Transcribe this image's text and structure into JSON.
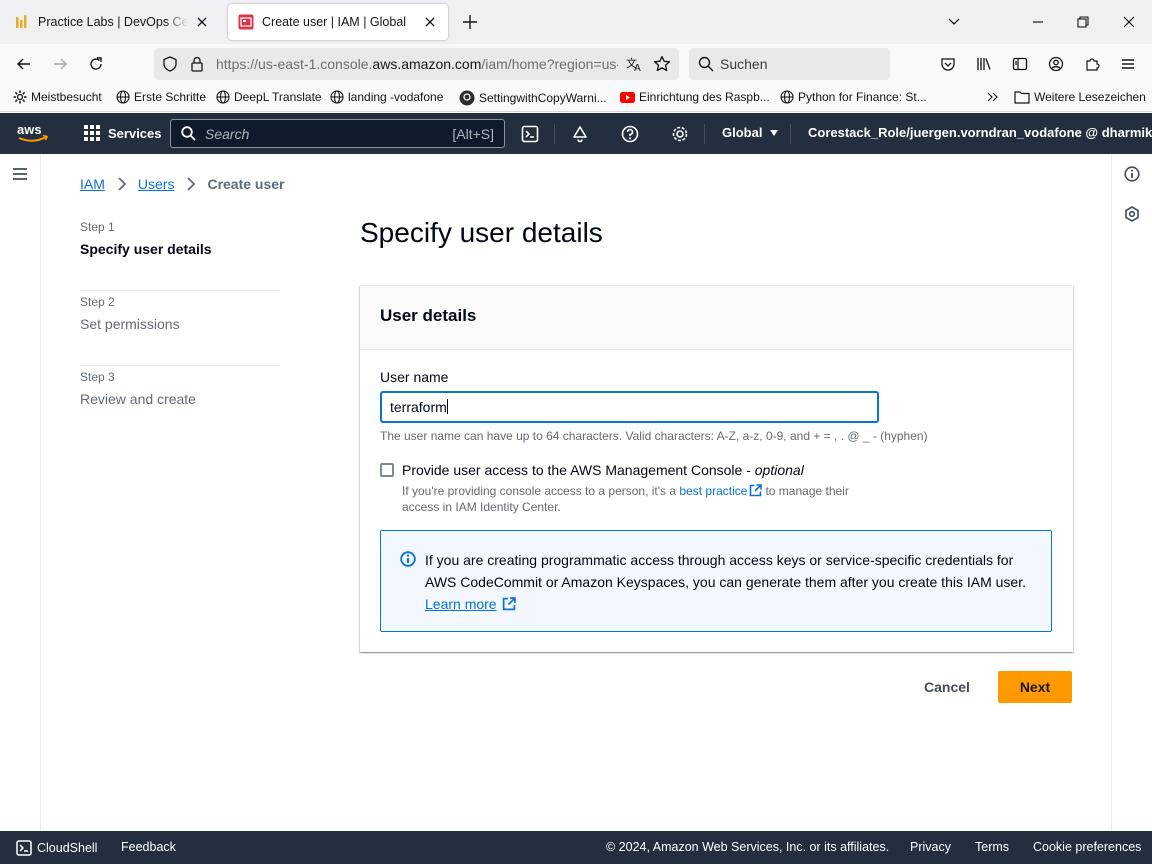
{
  "browser": {
    "tabs": [
      {
        "title": "Practice Labs | DevOps Certifica",
        "active": false
      },
      {
        "title": "Create user | IAM | Global",
        "active": true
      }
    ],
    "url_prefix": "https://us-east-1.console.",
    "url_domain": "aws.amazon.com",
    "url_suffix": "/iam/home?region=us-",
    "search_placeholder": "Suchen",
    "bookmarks": [
      "Meistbesucht",
      "Erste Schritte",
      "DeepL Translate",
      "landing -vodafone",
      "SettingwithCopyWarni...",
      "Einrichtung des Raspb...",
      "Python for Finance: St...",
      "Weitere Lesezeichen"
    ]
  },
  "aws_nav": {
    "services_label": "Services",
    "search_placeholder": "Search",
    "search_shortcut": "[Alt+S]",
    "region": "Global",
    "account": "Corestack_Role/juergen.vorndran_vodafone @ dharmika"
  },
  "breadcrumb": {
    "items": [
      "IAM",
      "Users"
    ],
    "current": "Create user"
  },
  "wizard": {
    "steps": [
      {
        "number": "Step 1",
        "title": "Specify user details",
        "active": true
      },
      {
        "number": "Step 2",
        "title": "Set permissions",
        "active": false
      },
      {
        "number": "Step 3",
        "title": "Review and create",
        "active": false
      }
    ]
  },
  "page_title": "Specify user details",
  "user_details": {
    "title": "User details",
    "username_label": "User name",
    "username_value": "terraform",
    "username_hint": "The user name can have up to 64 characters. Valid characters: A-Z, a-z, 0-9, and + = , . @ _ - (hyphen)",
    "console_access_label": "Provide user access to the AWS Management Console - ",
    "console_access_optional": "optional",
    "console_access_checked": false,
    "console_desc_before": "If you're providing console access to a person, it's a ",
    "console_desc_link": "best practice",
    "console_desc_after": "to manage their access in IAM Identity Center.",
    "info_text": "If you are creating programmatic access through access keys or service-specific credentials for AWS CodeCommit or Amazon Keyspaces, you can generate them after you create this IAM user.",
    "info_link": "Learn more"
  },
  "actions": {
    "cancel": "Cancel",
    "next": "Next"
  },
  "footer": {
    "cloudshell": "CloudShell",
    "feedback": "Feedback",
    "copyright": "© 2024, Amazon Web Services, Inc. or its affiliates.",
    "privacy": "Privacy",
    "terms": "Terms",
    "cookies": "Cookie preferences"
  },
  "colors": {
    "aws_nav_bg": "#232f3e",
    "link_blue": "#0972d3",
    "primary_orange": "#ff9900",
    "info_bg": "#f2f8fd"
  }
}
